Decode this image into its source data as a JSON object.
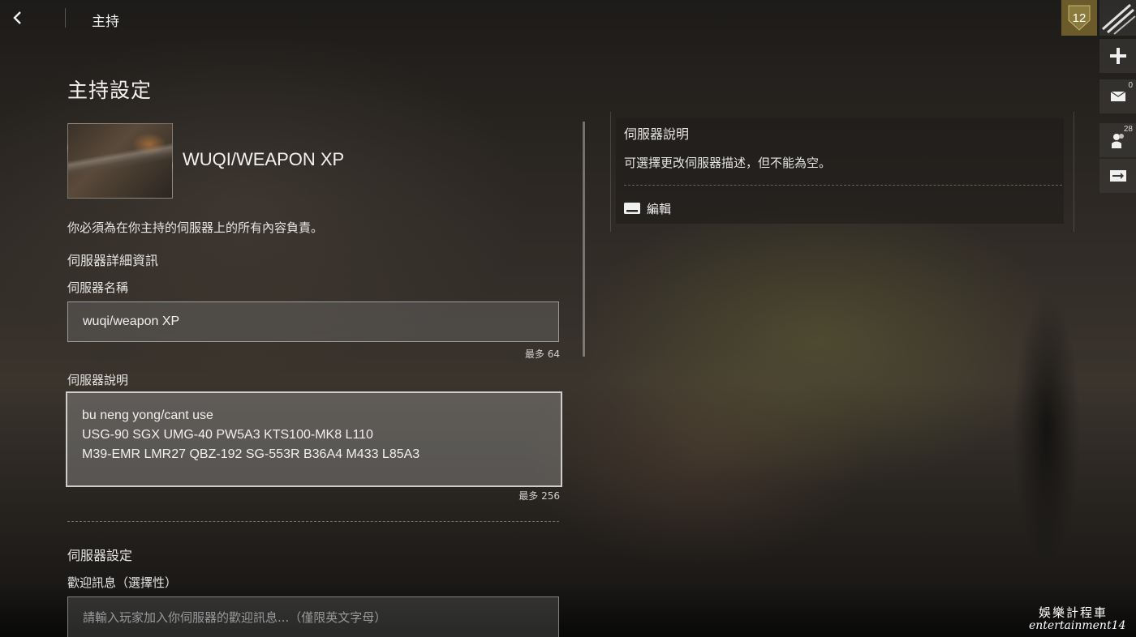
{
  "topbar": {
    "title": "主持"
  },
  "main": {
    "page_title": "主持設定",
    "server_title": "WUQI/WEAPON XP",
    "disclaimer": "你必須為在你主持的伺服器上的所有內容負責。",
    "section_details": "伺服器詳細資訊",
    "name_label": "伺服器名稱",
    "name_value": "wuqi/weapon XP",
    "name_max": "最多 64",
    "desc_label": "伺服器說明",
    "desc_lines": [
      "bu neng yong/cant use",
      "USG-90 SGX UMG-40 PW5A3 KTS100-MK8 L110",
      "M39-EMR LMR27 QBZ-192 SG-553R B36A4 M433 L85A3"
    ],
    "desc_max": "最多 256",
    "section_settings": "伺服器設定",
    "welcome_label": "歡迎訊息（選擇性）",
    "welcome_placeholder": "請輸入玩家加入你伺服器的歡迎訊息...（僅限英文字母）"
  },
  "info_panel": {
    "title": "伺服器說明",
    "text": "可選擇更改伺服器描述，但不能為空。",
    "edit_label": "編輯",
    "edit_icon": "keyboard-icon"
  },
  "sidebar": {
    "level": "12",
    "mail_count": "0",
    "friends_count": "28",
    "icons": [
      "plus-icon",
      "mail-icon",
      "friends-icon",
      "exit-icon"
    ]
  },
  "watermark": {
    "line1": "娛樂計程車",
    "line2": "entertainment14"
  },
  "colors": {
    "level_badge": "#6b5a2a",
    "panel_bg": "#1e1c1a"
  }
}
